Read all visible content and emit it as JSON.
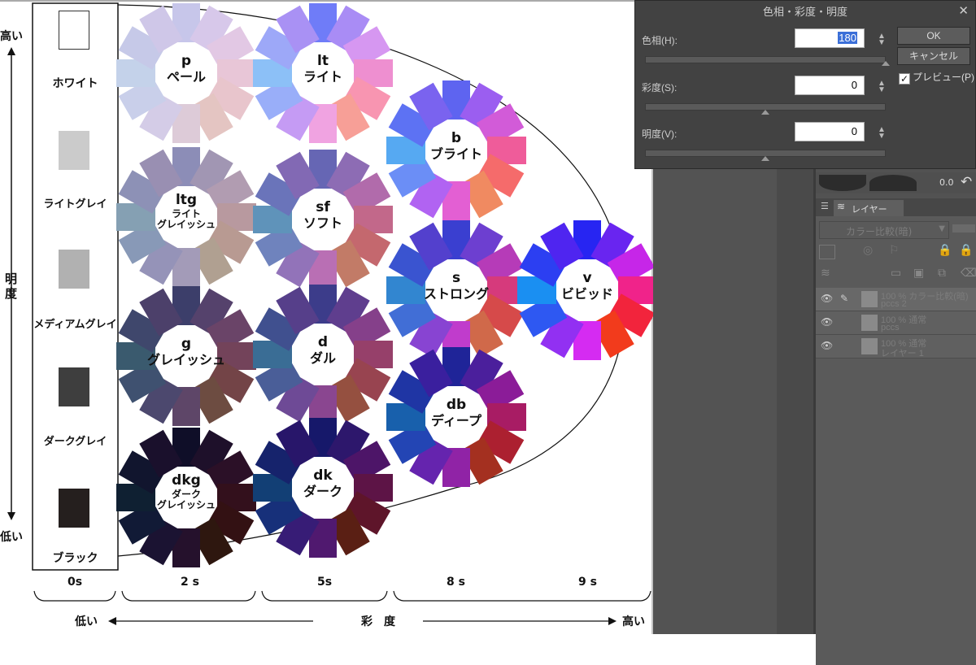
{
  "dialog": {
    "title": "色相・彩度・明度",
    "close": "✕",
    "hue_label": "色相(H):",
    "hue_value": "180",
    "saturation_label": "彩度(S):",
    "saturation_value": "0",
    "value_label": "明度(V):",
    "value_value": "0",
    "ok": "OK",
    "cancel": "キャンセル",
    "preview": "プレビュー(P)",
    "preview_checked": true
  },
  "toolbar": {
    "opacity_readout": "0.0"
  },
  "layer_panel": {
    "tab_label": "レイヤー",
    "blend_mode": "カラー比較(暗)",
    "layers": [
      {
        "line1": "100 % カラー比較(暗)",
        "line2": "pccs 2"
      },
      {
        "line1": "100 % 通常",
        "line2": "pccs"
      },
      {
        "line1": "100 % 通常",
        "line2": "レイヤー 1"
      }
    ]
  },
  "figure": {
    "lightness_high": "高い",
    "lightness_axis": "明度",
    "lightness_low": "低い",
    "saturation_low": "低い",
    "saturation_axis": "彩　度",
    "saturation_high": "高い",
    "greys": [
      "ホワイト",
      "ライトグレイ",
      "メディアムグレイ",
      "ダークグレイ",
      "ブラック"
    ],
    "grey_colors": [
      "#ffffff",
      "#cbcbcb",
      "#b1b1b1",
      "#3e3e3e",
      "#251f1e"
    ],
    "saturation_ticks": [
      "0s",
      "2 s",
      "5s",
      "8 s",
      "9 s"
    ],
    "tones": [
      {
        "code": "p",
        "name": "ペール",
        "colors": [
          "#c7c6ea",
          "#d7c8ea",
          "#e2c8e4",
          "#e8c6d7",
          "#e8c5cc",
          "#e4c5c2",
          "#ddcbd8",
          "#d4cce7",
          "#c9cfea",
          "#c4d2ea",
          "#c6c9e8",
          "#cfc7e8"
        ]
      },
      {
        "code": "lt",
        "name": "ライト",
        "colors": [
          "#6f7cf8",
          "#a98cf5",
          "#d697f1",
          "#ee8fd0",
          "#f895b1",
          "#f79f97",
          "#f0a3e1",
          "#c59bf4",
          "#99aef9",
          "#8cc0f7",
          "#9da8f8",
          "#a991f4"
        ]
      },
      {
        "code": "b",
        "name": "ブライト",
        "colors": [
          "#5e64f0",
          "#9b5ef0",
          "#d25bd8",
          "#ef5c9a",
          "#f56b6b",
          "#f08a61",
          "#e35fd3",
          "#b163f2",
          "#6b8ef6",
          "#56a9f2",
          "#5d72f3",
          "#7a63ef"
        ]
      },
      {
        "code": "ltg",
        "name": "ライト",
        "name2": "グレイッシュ",
        "colors": [
          "#8c8db7",
          "#a196b3",
          "#b19cb1",
          "#b8999f",
          "#b89a92",
          "#b0a091",
          "#a39bb8",
          "#9593b8",
          "#8899b7",
          "#85a0b3",
          "#8d91b6",
          "#998fb2"
        ]
      },
      {
        "code": "sf",
        "name": "ソフト",
        "colors": [
          "#6666b4",
          "#8d6cb4",
          "#b16bab",
          "#c2688a",
          "#c4686e",
          "#c27b67",
          "#b96fb4",
          "#9273b9",
          "#6f83bd",
          "#5f93ba",
          "#6a74ba",
          "#8269b4"
        ]
      },
      {
        "code": "s",
        "name": "ストロング",
        "colors": [
          "#3a3fd0",
          "#6d3fd0",
          "#b63bb8",
          "#d63a7c",
          "#d64a4a",
          "#d0694a",
          "#c03ccc",
          "#8844d2",
          "#416ed6",
          "#3286d0",
          "#3a54d0",
          "#5340cd"
        ]
      },
      {
        "code": "v",
        "name": "ビビッド",
        "colors": [
          "#2725f2",
          "#6925f0",
          "#c626e8",
          "#f0238a",
          "#f2243c",
          "#f23b1c",
          "#d52bf2",
          "#9230f2",
          "#2e58f2",
          "#1a8ff2",
          "#2c3ff2",
          "#4f25f0"
        ]
      },
      {
        "code": "g",
        "name": "グレイッシュ",
        "colors": [
          "#3c3e6a",
          "#55426c",
          "#6a4468",
          "#73435a",
          "#734447",
          "#6d4c41",
          "#5e4668",
          "#4c486e",
          "#3f5170",
          "#3a5a6e",
          "#3f476c",
          "#4c406a"
        ]
      },
      {
        "code": "d",
        "name": "ダル",
        "colors": [
          "#3c3c8a",
          "#5f3e8e",
          "#85408a",
          "#96406a",
          "#984450",
          "#955040",
          "#8a4690",
          "#6e4a96",
          "#4a5e98",
          "#3a6d95",
          "#40508f",
          "#563f8a"
        ]
      },
      {
        "code": "db",
        "name": "ディープ",
        "colors": [
          "#1f2498",
          "#4b1f9c",
          "#8b1c98",
          "#a81c64",
          "#ac2030",
          "#a43020",
          "#9023a6",
          "#6524ae",
          "#2345b4",
          "#1860ac",
          "#1f35a4",
          "#3a1f9e"
        ]
      },
      {
        "code": "dkg",
        "name": "ダーク",
        "name2": "グレイッシュ",
        "colors": [
          "#0f0e28",
          "#1e102a",
          "#2b1027",
          "#33101c",
          "#331113",
          "#2e170f",
          "#25112c",
          "#1b1332",
          "#111a36",
          "#0f2032",
          "#11152e",
          "#1a102c"
        ]
      },
      {
        "code": "dk",
        "name": "ダーク",
        "colors": [
          "#16186a",
          "#2d176c",
          "#4d1568",
          "#5d1446",
          "#5e152a",
          "#5a1f14",
          "#50196f",
          "#371c76",
          "#17307a",
          "#123f75",
          "#16236c",
          "#28166a"
        ]
      }
    ]
  }
}
